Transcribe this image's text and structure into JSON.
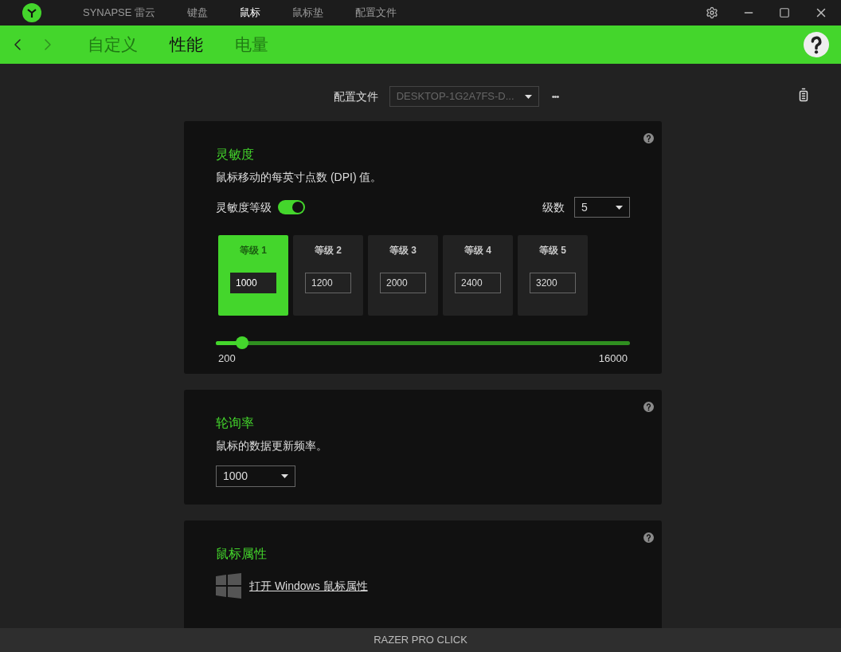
{
  "top_tabs": [
    {
      "label": "SYNAPSE 雷云",
      "selected": false
    },
    {
      "label": "键盘",
      "selected": false
    },
    {
      "label": "鼠标",
      "selected": true
    },
    {
      "label": "鼠标垫",
      "selected": false
    },
    {
      "label": "配置文件",
      "selected": false
    }
  ],
  "sub_tabs": [
    {
      "label": "自定义",
      "selected": false
    },
    {
      "label": "性能",
      "selected": true
    },
    {
      "label": "电量",
      "selected": false
    }
  ],
  "profile": {
    "label": "配置文件",
    "value": "DESKTOP-1G2A7FS-D...",
    "more": "•••"
  },
  "sensitivity": {
    "title": "灵敏度",
    "description": "鼠标移动的每英寸点数 (DPI) 值。",
    "stages_label": "灵敏度等级",
    "stages_on": true,
    "count_label": "级数",
    "count": "5",
    "stages": [
      {
        "label": "等级 1",
        "value": "1000",
        "selected": true
      },
      {
        "label": "等级 2",
        "value": "1200",
        "selected": false
      },
      {
        "label": "等级 3",
        "value": "2000",
        "selected": false
      },
      {
        "label": "等级 4",
        "value": "2400",
        "selected": false
      },
      {
        "label": "等级 5",
        "value": "3200",
        "selected": false
      }
    ],
    "slider": {
      "level": 0.064,
      "min": "200",
      "max": "16000"
    }
  },
  "polling": {
    "title": "轮询率",
    "description": "鼠标的数据更新频率。",
    "value": "1000"
  },
  "mouse_properties": {
    "title": "鼠标属性",
    "link": "打开 Windows 鼠标属性"
  },
  "status_bar": {
    "device": "RAZER PRO CLICK"
  }
}
